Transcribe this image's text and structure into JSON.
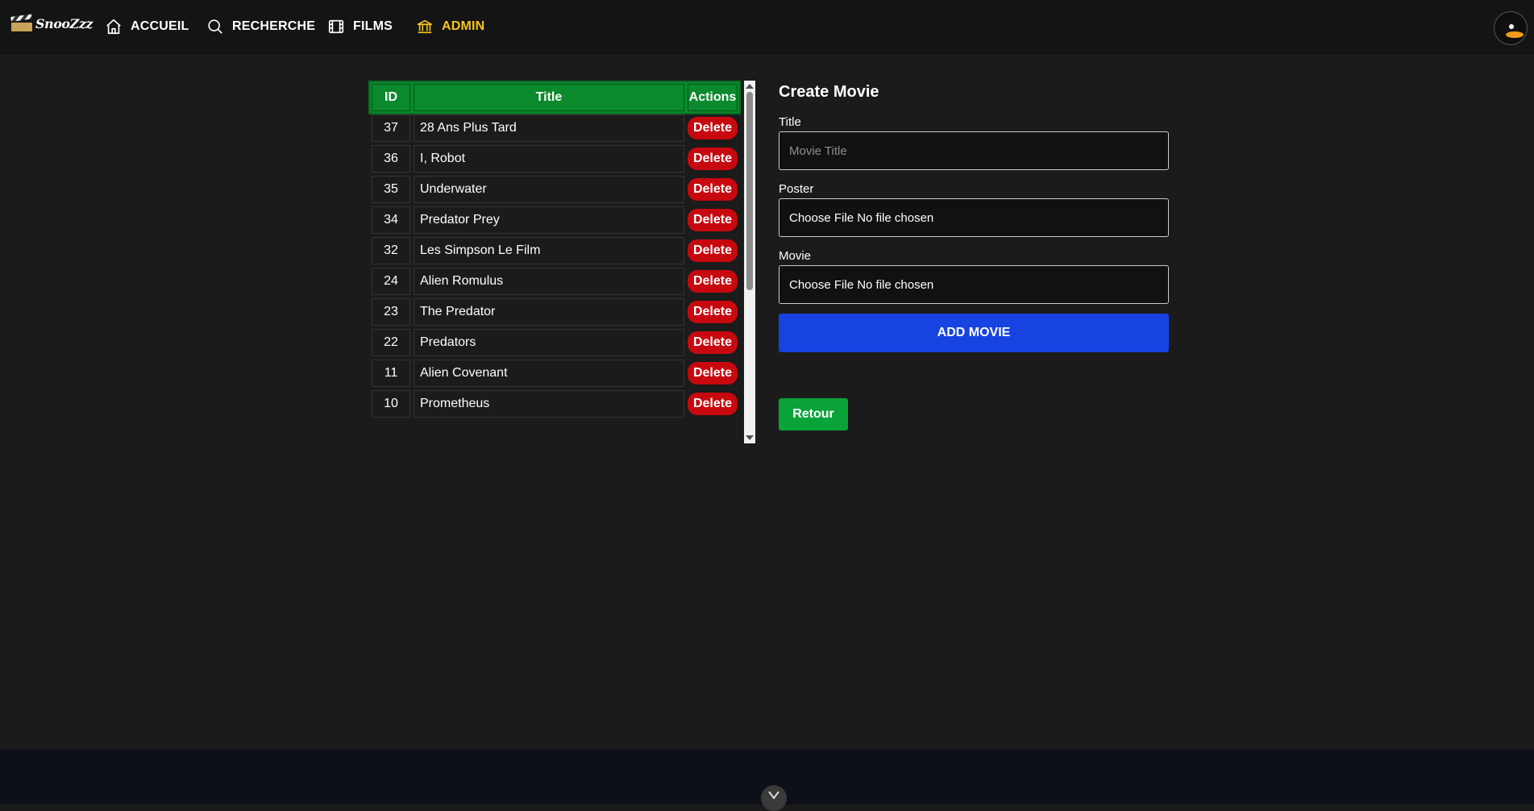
{
  "app": {
    "logo_text": "SnooZzz"
  },
  "nav": {
    "items": [
      {
        "label": "ACCUEIL",
        "icon": "home-icon"
      },
      {
        "label": "RECHERCHE",
        "icon": "search-icon"
      },
      {
        "label": "FILMS",
        "icon": "film-icon"
      },
      {
        "label": "ADMIN",
        "icon": "bank-icon",
        "active": true
      }
    ],
    "active_color": "#f5c518"
  },
  "table": {
    "headers": [
      "ID",
      "Title",
      "Actions"
    ],
    "rows": [
      {
        "id": "37",
        "title": "28 Ans Plus Tard",
        "action": "Delete"
      },
      {
        "id": "36",
        "title": "I, Robot",
        "action": "Delete"
      },
      {
        "id": "35",
        "title": "Underwater",
        "action": "Delete"
      },
      {
        "id": "34",
        "title": "Predator Prey",
        "action": "Delete"
      },
      {
        "id": "32",
        "title": "Les Simpson Le Film",
        "action": "Delete"
      },
      {
        "id": "24",
        "title": "Alien Romulus",
        "action": "Delete"
      },
      {
        "id": "23",
        "title": "The Predator",
        "action": "Delete"
      },
      {
        "id": "22",
        "title": "Predators",
        "action": "Delete"
      },
      {
        "id": "11",
        "title": "Alien Covenant",
        "action": "Delete"
      },
      {
        "id": "10",
        "title": "Prometheus",
        "action": "Delete"
      }
    ],
    "header_color": "#0a8a2c",
    "delete_color": "#c8080f"
  },
  "form": {
    "heading": "Create Movie",
    "title_label": "Title",
    "title_placeholder": "Movie Title",
    "poster_label": "Poster",
    "poster_value": "Choose File No file chosen",
    "movie_label": "Movie",
    "movie_value": "Choose File No file chosen",
    "submit_label": "ADD MOVIE",
    "submit_color": "#1743e0",
    "back_label": "Retour",
    "back_color": "#0aa33a"
  }
}
